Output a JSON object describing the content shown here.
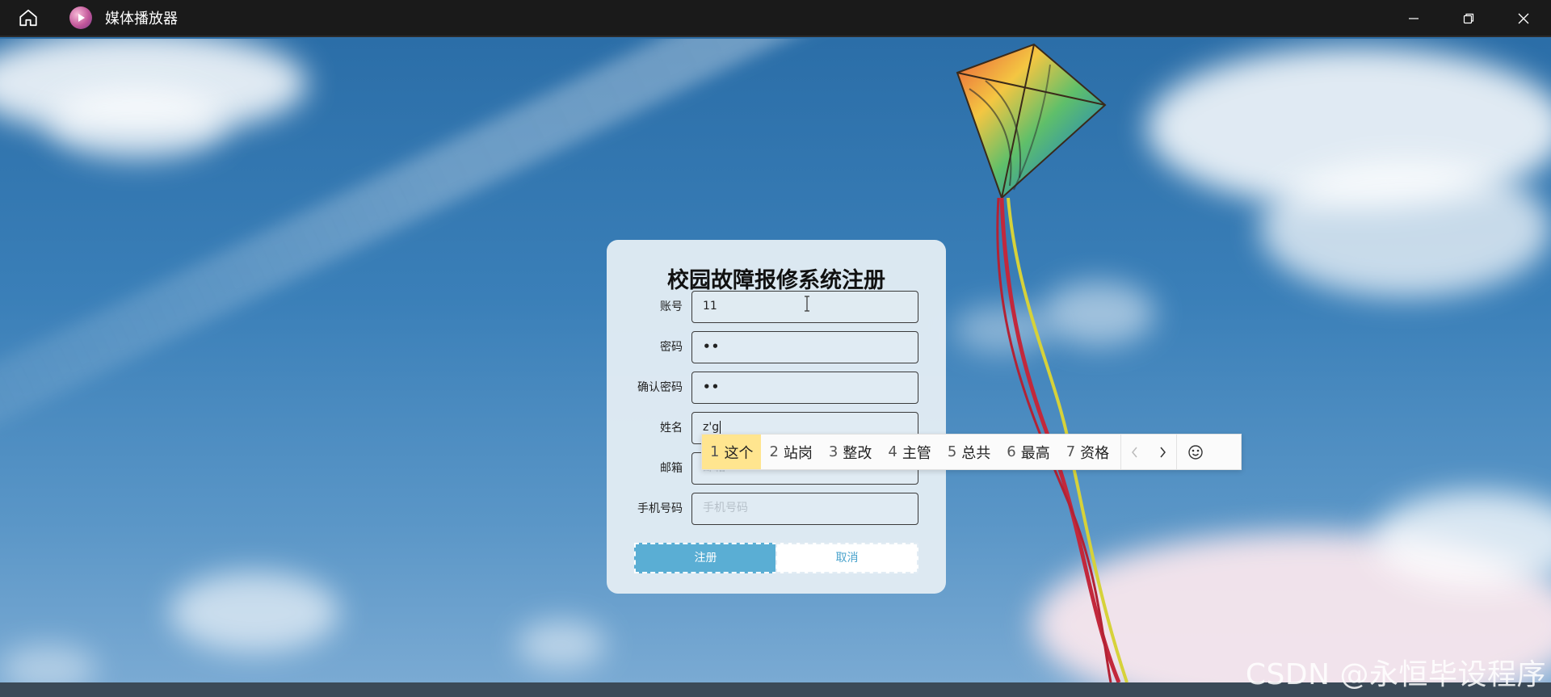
{
  "window": {
    "title": "媒体播放器",
    "controls": [
      "minimize",
      "restore",
      "close"
    ]
  },
  "form": {
    "title": "校园故障报修系统注册",
    "fields": [
      {
        "label": "账号",
        "value": "11",
        "placeholder": ""
      },
      {
        "label": "密码",
        "value": "••",
        "placeholder": ""
      },
      {
        "label": "确认密码",
        "value": "••",
        "placeholder": ""
      },
      {
        "label": "姓名",
        "value": "z'g",
        "placeholder": ""
      },
      {
        "label": "邮箱",
        "value": "",
        "placeholder": "邮箱"
      },
      {
        "label": "手机号码",
        "value": "",
        "placeholder": "手机号码"
      }
    ],
    "register_label": "注册",
    "cancel_label": "取消"
  },
  "ime": {
    "candidates": [
      {
        "num": "1",
        "text": "这个",
        "selected": true
      },
      {
        "num": "2",
        "text": "站岗"
      },
      {
        "num": "3",
        "text": "整改"
      },
      {
        "num": "4",
        "text": "主管"
      },
      {
        "num": "5",
        "text": "总共"
      },
      {
        "num": "6",
        "text": "最高"
      },
      {
        "num": "7",
        "text": "资格"
      }
    ],
    "highlight_color": "#ffe58f"
  },
  "watermark": "CSDN @永恒毕设程序",
  "colors": {
    "titlebar": "#1a1a1a",
    "register_button": "#5aaed4",
    "card": "#e2ecf4"
  }
}
